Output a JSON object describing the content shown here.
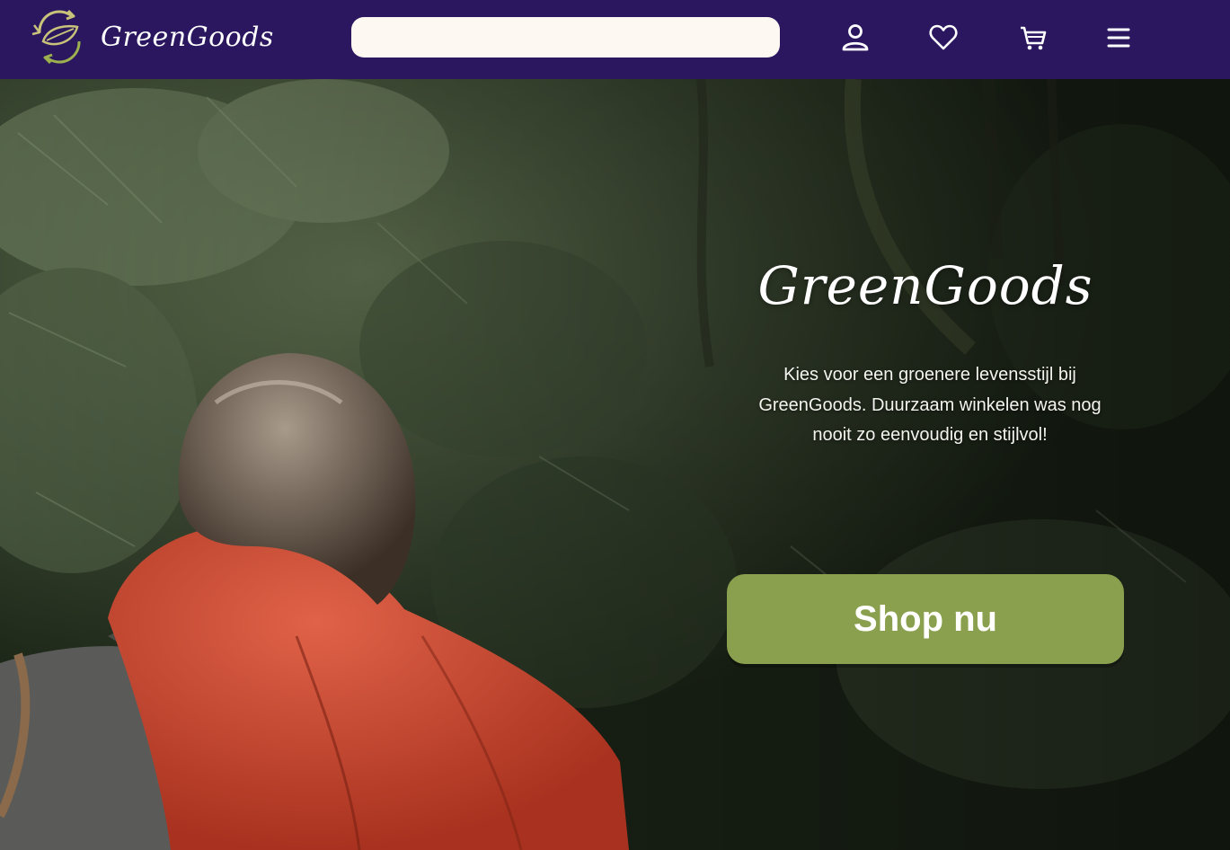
{
  "header": {
    "brand": "GreenGoods",
    "logo_icon": "recycle-leaf-logo",
    "search": {
      "value": "",
      "placeholder": ""
    },
    "icons": [
      "user-icon",
      "heart-icon",
      "cart-icon",
      "menu-icon"
    ]
  },
  "hero": {
    "title": "GreenGoods",
    "text": "Kies voor een groenere levensstijl bij GreenGoods. Duurzaam winkelen was nog nooit zo eenvoudig en stijlvol!",
    "button_label": "Shop nu",
    "image": "hiker-in-forest-photo"
  },
  "colors": {
    "header_bg": "#2a1760",
    "accent_green": "#8aa04e",
    "search_bg": "#fdf8f1"
  }
}
